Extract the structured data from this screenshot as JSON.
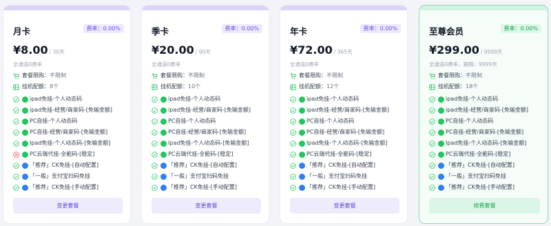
{
  "plans": [
    {
      "name": "月卡",
      "rate": "费率：0.00%",
      "price": "¥8.00",
      "period": "/ 30天",
      "subtitle": "全通道0费率",
      "limit_label": "套餐限购：",
      "limit_value": "不限制",
      "config_label": "挂机配额：",
      "config_value": "8个",
      "button": "变更套餐",
      "features": [
        {
          "status": "check",
          "bubble": "wechat",
          "text": "ipad免挂-个人动态码"
        },
        {
          "status": "check",
          "bubble": "wechat",
          "text": "ipad免挂-经营/商家码-[免输金额]"
        },
        {
          "status": "check",
          "bubble": "wechat",
          "text": "PC自挂-个人动态码"
        },
        {
          "status": "check",
          "bubble": "wechat",
          "text": "PC自挂-经营/商家码-[免输金额]"
        },
        {
          "status": "check",
          "bubble": "wechat",
          "text": "Ipad免挂-个人动态码-[免输金额]"
        },
        {
          "status": "cross",
          "bubble": "wechat",
          "text": "PC云端代挂-全能码-[稳定]"
        },
        {
          "status": "check",
          "bubble": "alipay",
          "text": "「推荐」CK免挂-[自动配置]"
        },
        {
          "status": "check",
          "bubble": "alipay",
          "text": "「一般」支付宝扫码免挂"
        },
        {
          "status": "check",
          "bubble": "alipay",
          "text": "「推荐」CK免挂-[手动配置]"
        }
      ]
    },
    {
      "name": "季卡",
      "rate": "费率：0.00%",
      "price": "¥20.00",
      "period": "/ 90天",
      "subtitle": "全通道0费率",
      "limit_label": "套餐限购：",
      "limit_value": "不限制",
      "config_label": "挂机配额：",
      "config_value": "10个",
      "button": "变更套餐",
      "features": [
        {
          "status": "check",
          "bubble": "wechat",
          "text": "ipad免挂-个人动态码"
        },
        {
          "status": "check",
          "bubble": "wechat",
          "text": "ipad免挂-经营/商家码-[免输金额]"
        },
        {
          "status": "check",
          "bubble": "wechat",
          "text": "PC自挂-个人动态码"
        },
        {
          "status": "check",
          "bubble": "wechat",
          "text": "PC自挂-经营/商家码-[免输金额]"
        },
        {
          "status": "check",
          "bubble": "wechat",
          "text": "Ipad免挂-个人动态码-[免输金额]"
        },
        {
          "status": "check",
          "bubble": "wechat",
          "text": "PC云端代挂-全能码-[稳定]"
        },
        {
          "status": "check",
          "bubble": "alipay",
          "text": "「推荐」CK免挂-[自动配置]"
        },
        {
          "status": "check",
          "bubble": "alipay",
          "text": "「一般」支付宝扫码免挂"
        },
        {
          "status": "check",
          "bubble": "alipay",
          "text": "「推荐」CK免挂-[手动配置]"
        }
      ]
    },
    {
      "name": "年卡",
      "rate": "费率：0.00%",
      "price": "¥72.00",
      "period": "/ 365天",
      "subtitle": "全通道0费率",
      "limit_label": "套餐限购：",
      "limit_value": "不限制",
      "config_label": "挂机配额：",
      "config_value": "12个",
      "button": "变更套餐",
      "features": [
        {
          "status": "check",
          "bubble": "wechat",
          "text": "ipad免挂-个人动态码"
        },
        {
          "status": "check",
          "bubble": "wechat",
          "text": "ipad免挂-经营/商家码-[免输金额]"
        },
        {
          "status": "check",
          "bubble": "wechat",
          "text": "PC自挂-个人动态码"
        },
        {
          "status": "check",
          "bubble": "wechat",
          "text": "PC自挂-经营/商家码-[免输金额]"
        },
        {
          "status": "check",
          "bubble": "wechat",
          "text": "Ipad免挂-个人动态码-[免输金额]"
        },
        {
          "status": "check",
          "bubble": "wechat",
          "text": "PC云端代挂-全能码-[稳定]"
        },
        {
          "status": "check",
          "bubble": "alipay",
          "text": "「推荐」CK免挂-[自动配置]"
        },
        {
          "status": "check",
          "bubble": "alipay",
          "text": "「一般」支付宝扫码免挂"
        },
        {
          "status": "check",
          "bubble": "alipay",
          "text": "「推荐」CK免挂-[手动配置]"
        }
      ]
    },
    {
      "name": "至尊会员",
      "rate": "费率：0.00%",
      "price": "¥299.00",
      "period": "/ 9999天",
      "subtitle": "全通道0费率，期限：9999天",
      "limit_label": "套餐限购：",
      "limit_value": "不限制",
      "config_label": "挂机配额：",
      "config_value": "18个",
      "button": "续费套餐",
      "features": [
        {
          "status": "check",
          "bubble": "wechat",
          "text": "ipad免挂-个人动态码"
        },
        {
          "status": "check",
          "bubble": "wechat",
          "text": "ipad免挂-经营/商家码-[免输金额]"
        },
        {
          "status": "check",
          "bubble": "wechat",
          "text": "PC自挂-个人动态码"
        },
        {
          "status": "check",
          "bubble": "wechat",
          "text": "PC自挂-经营/商家码-[免输金额]"
        },
        {
          "status": "check",
          "bubble": "wechat",
          "text": "Ipad免挂-个人动态码-[免输金额]"
        },
        {
          "status": "check",
          "bubble": "wechat",
          "text": "PC云端代挂-全能码-[稳定]"
        },
        {
          "status": "check",
          "bubble": "alipay",
          "text": "「推荐」CK免挂-[自动配置]"
        },
        {
          "status": "check",
          "bubble": "alipay",
          "text": "「一般」支付宝扫码免挂"
        },
        {
          "status": "check",
          "bubble": "alipay",
          "text": "「推荐」CK免挂-[手动配置]"
        }
      ]
    }
  ],
  "icons": {
    "limit": "cart-icon",
    "config": "list-icon",
    "check": "check-circle-icon",
    "cross": "x-circle-icon",
    "wechat": "wechat-icon",
    "alipay": "alipay-icon"
  },
  "colors": {
    "accent": "#6d4fe0",
    "current_plan": "#16a34a",
    "included": "#22c55e",
    "excluded": "#ef4444",
    "alipay": "#2f7ef5"
  }
}
